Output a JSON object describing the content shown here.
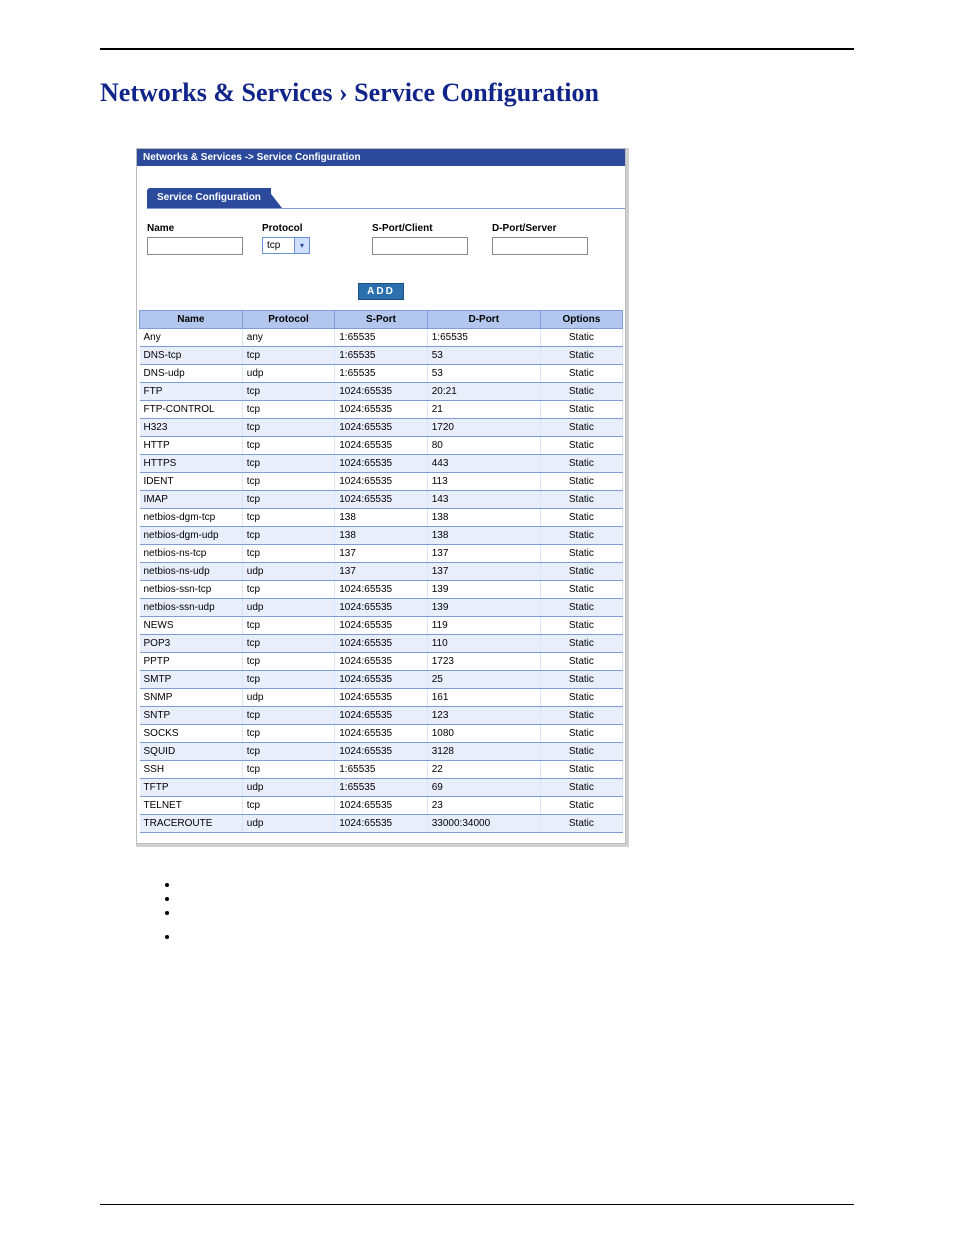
{
  "page_title": "Networks & Services › Service Configuration",
  "crumb": "Networks & Services  ->  Service Configuration",
  "tab_label": "Service Configuration",
  "form": {
    "name_label": "Name",
    "protocol_label": "Protocol",
    "sport_label": "S-Port/Client",
    "dport_label": "D-Port/Server",
    "protocol_value": "tcp",
    "add_label": "ADD"
  },
  "table": {
    "headers": {
      "name": "Name",
      "protocol": "Protocol",
      "sport": "S-Port",
      "dport": "D-Port",
      "options": "Options"
    },
    "rows": [
      {
        "name": "Any",
        "protocol": "any",
        "sport": "1:65535",
        "dport": "1:65535",
        "options": "Static"
      },
      {
        "name": "DNS-tcp",
        "protocol": "tcp",
        "sport": "1:65535",
        "dport": "53",
        "options": "Static"
      },
      {
        "name": "DNS-udp",
        "protocol": "udp",
        "sport": "1:65535",
        "dport": "53",
        "options": "Static"
      },
      {
        "name": "FTP",
        "protocol": "tcp",
        "sport": "1024:65535",
        "dport": "20:21",
        "options": "Static"
      },
      {
        "name": "FTP-CONTROL",
        "protocol": "tcp",
        "sport": "1024:65535",
        "dport": "21",
        "options": "Static"
      },
      {
        "name": "H323",
        "protocol": "tcp",
        "sport": "1024:65535",
        "dport": "1720",
        "options": "Static"
      },
      {
        "name": "HTTP",
        "protocol": "tcp",
        "sport": "1024:65535",
        "dport": "80",
        "options": "Static"
      },
      {
        "name": "HTTPS",
        "protocol": "tcp",
        "sport": "1024:65535",
        "dport": "443",
        "options": "Static"
      },
      {
        "name": "IDENT",
        "protocol": "tcp",
        "sport": "1024:65535",
        "dport": "113",
        "options": "Static"
      },
      {
        "name": "IMAP",
        "protocol": "tcp",
        "sport": "1024:65535",
        "dport": "143",
        "options": "Static"
      },
      {
        "name": "netbios-dgm-tcp",
        "protocol": "tcp",
        "sport": "138",
        "dport": "138",
        "options": "Static"
      },
      {
        "name": "netbios-dgm-udp",
        "protocol": "tcp",
        "sport": "138",
        "dport": "138",
        "options": "Static"
      },
      {
        "name": "netbios-ns-tcp",
        "protocol": "tcp",
        "sport": "137",
        "dport": "137",
        "options": "Static"
      },
      {
        "name": "netbios-ns-udp",
        "protocol": "udp",
        "sport": "137",
        "dport": "137",
        "options": "Static"
      },
      {
        "name": "netbios-ssn-tcp",
        "protocol": "tcp",
        "sport": "1024:65535",
        "dport": "139",
        "options": "Static"
      },
      {
        "name": "netbios-ssn-udp",
        "protocol": "udp",
        "sport": "1024:65535",
        "dport": "139",
        "options": "Static"
      },
      {
        "name": "NEWS",
        "protocol": "tcp",
        "sport": "1024:65535",
        "dport": "119",
        "options": "Static"
      },
      {
        "name": "POP3",
        "protocol": "tcp",
        "sport": "1024:65535",
        "dport": "110",
        "options": "Static"
      },
      {
        "name": "PPTP",
        "protocol": "tcp",
        "sport": "1024:65535",
        "dport": "1723",
        "options": "Static"
      },
      {
        "name": "SMTP",
        "protocol": "tcp",
        "sport": "1024:65535",
        "dport": "25",
        "options": "Static"
      },
      {
        "name": "SNMP",
        "protocol": "udp",
        "sport": "1024:65535",
        "dport": "161",
        "options": "Static"
      },
      {
        "name": "SNTP",
        "protocol": "tcp",
        "sport": "1024:65535",
        "dport": "123",
        "options": "Static"
      },
      {
        "name": "SOCKS",
        "protocol": "tcp",
        "sport": "1024:65535",
        "dport": "1080",
        "options": "Static"
      },
      {
        "name": "SQUID",
        "protocol": "tcp",
        "sport": "1024:65535",
        "dport": "3128",
        "options": "Static"
      },
      {
        "name": "SSH",
        "protocol": "tcp",
        "sport": "1:65535",
        "dport": "22",
        "options": "Static"
      },
      {
        "name": "TFTP",
        "protocol": "udp",
        "sport": "1:65535",
        "dport": "69",
        "options": "Static"
      },
      {
        "name": "TELNET",
        "protocol": "tcp",
        "sport": "1024:65535",
        "dport": "23",
        "options": "Static"
      },
      {
        "name": "TRACEROUTE",
        "protocol": "udp",
        "sport": "1024:65535",
        "dport": "33000:34000",
        "options": "Static"
      }
    ]
  }
}
